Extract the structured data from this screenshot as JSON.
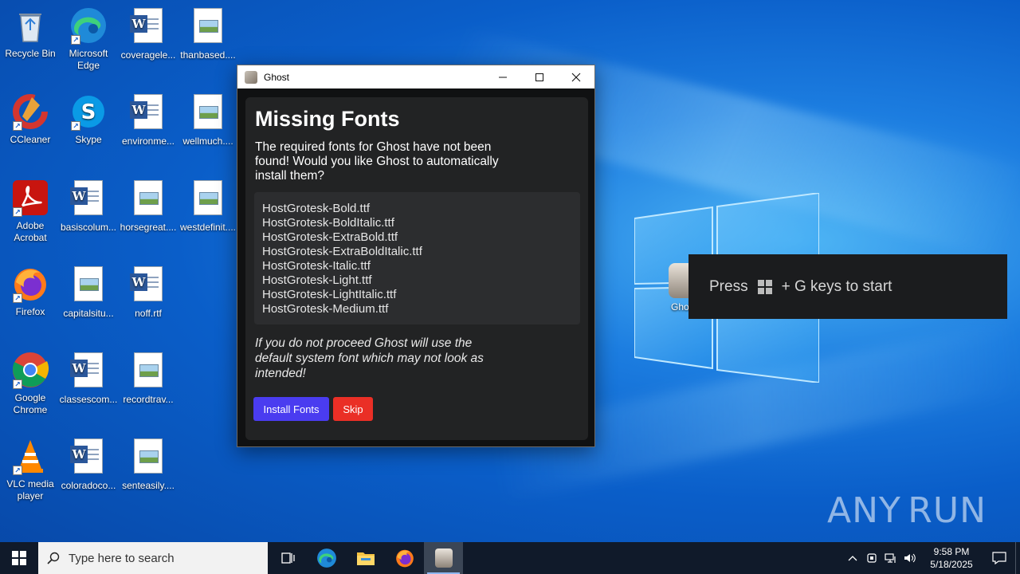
{
  "desktop": {
    "icons": [
      {
        "label": "Recycle Bin",
        "icon": "recycle-bin-icon"
      },
      {
        "label": "Microsoft Edge",
        "icon": "edge-icon"
      },
      {
        "label": "coveragele...",
        "icon": "word-doc-icon"
      },
      {
        "label": "thanbased....",
        "icon": "image-file-icon"
      },
      {
        "label": "CCleaner",
        "icon": "ccleaner-icon"
      },
      {
        "label": "Skype",
        "icon": "skype-icon"
      },
      {
        "label": "environme...",
        "icon": "word-doc-icon"
      },
      {
        "label": "wellmuch....",
        "icon": "image-file-icon"
      },
      {
        "label": "Adobe Acrobat",
        "icon": "acrobat-icon"
      },
      {
        "label": "basiscolum...",
        "icon": "word-doc-icon"
      },
      {
        "label": "horsegreat....",
        "icon": "image-file-icon"
      },
      {
        "label": "westdefinit....",
        "icon": "image-file-icon"
      },
      {
        "label": "Firefox",
        "icon": "firefox-icon"
      },
      {
        "label": "capitalsitu...",
        "icon": "image-file-icon"
      },
      {
        "label": "noff.rtf",
        "icon": "word-doc-icon"
      },
      {
        "label": "Google Chrome",
        "icon": "chrome-icon"
      },
      {
        "label": "classescom...",
        "icon": "word-doc-icon"
      },
      {
        "label": "recordtrav...",
        "icon": "image-file-icon"
      },
      {
        "label": "VLC media player",
        "icon": "vlc-icon"
      },
      {
        "label": "coloradoco...",
        "icon": "word-doc-icon"
      },
      {
        "label": "senteasily....",
        "icon": "image-file-icon"
      }
    ],
    "ghost_icon_label": "Ghost"
  },
  "window": {
    "title": "Ghost",
    "heading": "Missing Fonts",
    "description": "The required fonts for Ghost have not been found! Would you like Ghost to automatically install them?",
    "fonts": [
      "HostGrotesk-Bold.ttf",
      "HostGrotesk-BoldItalic.ttf",
      "HostGrotesk-ExtraBold.ttf",
      "HostGrotesk-ExtraBoldItalic.ttf",
      "HostGrotesk-Italic.ttf",
      "HostGrotesk-Light.ttf",
      "HostGrotesk-LightItalic.ttf",
      "HostGrotesk-Medium.ttf"
    ],
    "note": "If you do not proceed Ghost will use the default system font which may not look as intended!",
    "install_label": "Install Fonts",
    "skip_label": "Skip",
    "install_color": "#4a3cf0",
    "skip_color": "#ea2f26"
  },
  "toast": {
    "prefix": "Press",
    "suffix": "+ G keys to start"
  },
  "watermark": {
    "left": "ANY",
    "right": "RUN"
  },
  "taskbar": {
    "search_placeholder": "Type here to search",
    "time": "9:58 PM",
    "date": "5/18/2025"
  }
}
